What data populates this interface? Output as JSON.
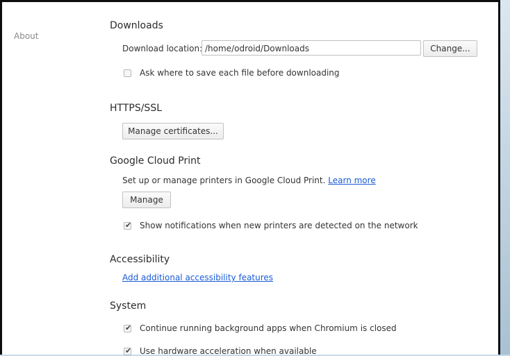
{
  "sidebar": {
    "about_label": "About"
  },
  "downloads": {
    "title": "Downloads",
    "location_label": "Download location:",
    "location_value": "/home/odroid/Downloads",
    "change_label": "Change...",
    "ask_label": "Ask where to save each file before downloading",
    "ask_checked": false
  },
  "https": {
    "title": "HTTPS/SSL",
    "manage_certs_label": "Manage certificates..."
  },
  "cloud_print": {
    "title": "Google Cloud Print",
    "description": "Set up or manage printers in Google Cloud Print.",
    "learn_more_label": "Learn more",
    "manage_label": "Manage",
    "notify_label": "Show notifications when new printers are detected on the network",
    "notify_checked": true
  },
  "accessibility": {
    "title": "Accessibility",
    "link_label": "Add additional accessibility features"
  },
  "system": {
    "title": "System",
    "background_label": "Continue running background apps when Chromium is closed",
    "background_checked": true,
    "hw_accel_label": "Use hardware acceleration when available",
    "hw_accel_checked": true
  },
  "colors": {
    "link": "#1a5bd6",
    "frame": "#0d0d0d",
    "desktop": "#c9d9e6"
  },
  "icons": {
    "check": "check-icon"
  }
}
